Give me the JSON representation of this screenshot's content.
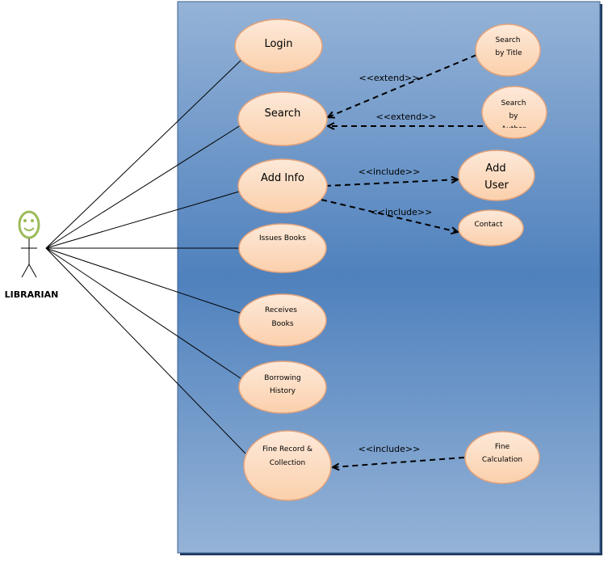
{
  "actor": {
    "name": "LIBRARIAN",
    "icon": "stick-figure-smiley-icon",
    "head_color": "#9bbb59"
  },
  "colors": {
    "system_top": "#95b3d7",
    "system_mid": "#4f81bd",
    "usecase_fill_top": "#fde9d9",
    "usecase_fill_bottom": "#fbd4b4",
    "usecase_border": "#e4a37a"
  },
  "use_cases": {
    "login": [
      "Login"
    ],
    "search": [
      "Search"
    ],
    "add_info": [
      "Add Info"
    ],
    "issues_books": [
      "Issues Books"
    ],
    "receives_books": [
      "Receives",
      "Books"
    ],
    "borrowing_history": [
      "Borrowing",
      "History"
    ],
    "fine_record": [
      "Fine Record &",
      "Collection"
    ],
    "search_by_title": [
      "Search",
      "by Title"
    ],
    "search_by_author": [
      "Search",
      "by",
      "Author"
    ],
    "add_user": [
      "Add",
      "User"
    ],
    "contact": [
      "Contact"
    ],
    "fine_calculation": [
      "Fine",
      "Calculation"
    ]
  },
  "relations": {
    "extend_title": "<<extend>>",
    "extend_author": "<<extend>>",
    "include_add_user": "<<include>>",
    "include_contact": "<<include>>",
    "include_fine": "<<include>>"
  }
}
